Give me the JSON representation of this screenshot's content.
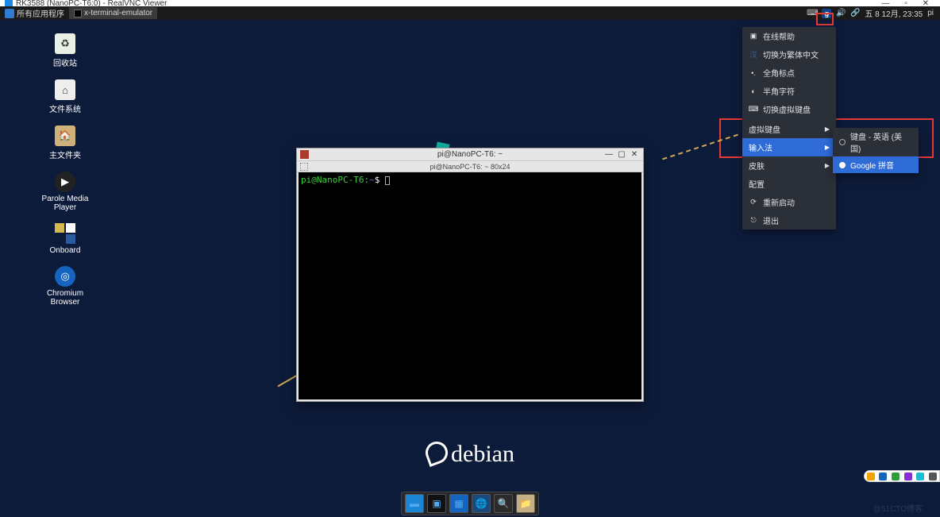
{
  "vnc_window_title": "RK3588 (NanoPC-T6:0) - RealVNC Viewer",
  "win_buttons": {
    "min": "—",
    "max": "▫",
    "close": "✕"
  },
  "panel": {
    "apps_label": "所有应用程序",
    "task_label": "x-terminal-emulator",
    "clock": "五  8 12月, 23:35",
    "user": "pi",
    "ime_glyph": "g"
  },
  "fcitx": {
    "help": "在线帮助",
    "han_glyph": "汉",
    "switcht": "切换为繁体中文",
    "fullpunc": "全角标点",
    "halfchar": "半角字符",
    "togglevk": "切换虚拟键盘",
    "vkeyboard": "虚拟键盘",
    "inputm": "输入法",
    "skin": "皮肤",
    "config": "配置",
    "restart": "重新启动",
    "exit": "退出",
    "sub_kb": "键盘 - 英语 (美国)",
    "sub_google": "Google 拼音"
  },
  "icons": {
    "trash": "回收站",
    "fs": "文件系统",
    "home": "主文件夹",
    "parole": "Parole Media Player",
    "onboard": "Onboard",
    "chromium": "Chromium Browser"
  },
  "terminal": {
    "title": "pi@NanoPC-T6: ~",
    "tab_title": "pi@NanoPC-T6: ~ 80x24",
    "prompt_user": "pi@NanoPC-T6",
    "prompt_path": "~",
    "prompt_sym": "$"
  },
  "debian": "debian",
  "watermark": "@51CTO博客"
}
